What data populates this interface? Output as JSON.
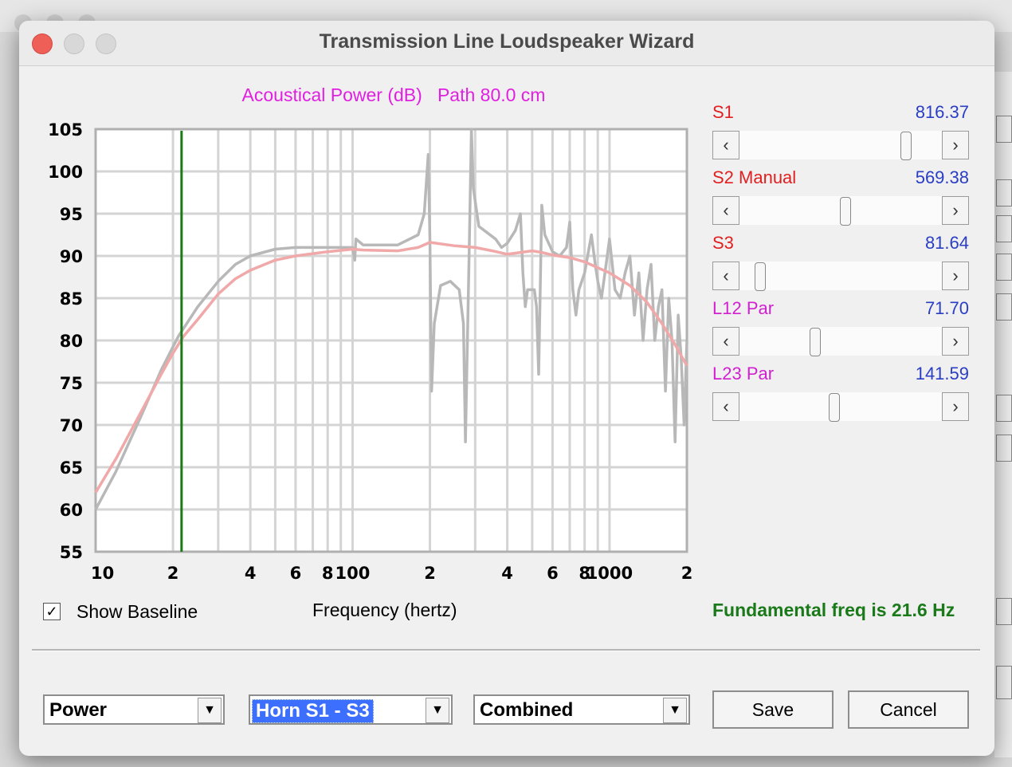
{
  "window": {
    "title": "Transmission Line Loudspeaker Wizard"
  },
  "chart_header": {
    "title": "Acoustical Power (dB)   Path 80.0 cm"
  },
  "chart_data": {
    "type": "line",
    "title": "Acoustical Power (dB)   Path 80.0 cm",
    "xlabel": "Frequency (hertz)",
    "ylabel": "",
    "x_scale": "log",
    "xlim": [
      10,
      2000
    ],
    "ylim": [
      55,
      105
    ],
    "y_ticks": [
      "105",
      "100",
      "95",
      "90",
      "85",
      "80",
      "75",
      "70",
      "65",
      "60",
      "55"
    ],
    "x_ticks": [
      {
        "value": 10,
        "label": "10"
      },
      {
        "value": 20,
        "label": "2"
      },
      {
        "value": 40,
        "label": "4"
      },
      {
        "value": 60,
        "label": "6"
      },
      {
        "value": 80,
        "label": "8"
      },
      {
        "value": 100,
        "label": "100"
      },
      {
        "value": 200,
        "label": "2"
      },
      {
        "value": 400,
        "label": "4"
      },
      {
        "value": 600,
        "label": "6"
      },
      {
        "value": 800,
        "label": "8"
      },
      {
        "value": 1000,
        "label": "1000"
      },
      {
        "value": 2000,
        "label": "2"
      }
    ],
    "marker_line": {
      "x": 21.6,
      "color": "#1a7a1a"
    },
    "series": [
      {
        "color": "#b8b8b8",
        "points": [
          [
            10,
            60
          ],
          [
            12,
            64.5
          ],
          [
            15,
            71
          ],
          [
            18,
            76.5
          ],
          [
            21,
            80.5
          ],
          [
            25,
            84
          ],
          [
            30,
            87
          ],
          [
            35,
            89
          ],
          [
            40,
            90
          ],
          [
            50,
            90.8
          ],
          [
            60,
            91
          ],
          [
            80,
            91
          ],
          [
            100,
            91
          ],
          [
            102,
            89.5
          ],
          [
            103,
            92
          ],
          [
            110,
            91.3
          ],
          [
            150,
            91.3
          ],
          [
            180,
            92.5
          ],
          [
            190,
            95
          ],
          [
            197,
            102
          ],
          [
            200,
            92
          ],
          [
            203,
            74
          ],
          [
            208,
            82
          ],
          [
            220,
            86.5
          ],
          [
            240,
            87
          ],
          [
            260,
            86
          ],
          [
            270,
            82
          ],
          [
            275,
            68
          ],
          [
            285,
            92
          ],
          [
            290,
            105
          ],
          [
            295,
            98
          ],
          [
            310,
            93.5
          ],
          [
            360,
            92
          ],
          [
            380,
            91
          ],
          [
            400,
            91.5
          ],
          [
            430,
            93
          ],
          [
            450,
            95
          ],
          [
            460,
            88
          ],
          [
            470,
            84
          ],
          [
            480,
            86
          ],
          [
            510,
            86
          ],
          [
            520,
            84
          ],
          [
            530,
            76
          ],
          [
            545,
            96
          ],
          [
            560,
            92.5
          ],
          [
            600,
            90.5
          ],
          [
            640,
            90
          ],
          [
            680,
            91
          ],
          [
            700,
            94
          ],
          [
            720,
            86
          ],
          [
            740,
            83
          ],
          [
            760,
            86
          ],
          [
            800,
            88
          ],
          [
            850,
            92.5
          ],
          [
            880,
            89
          ],
          [
            900,
            87
          ],
          [
            930,
            85
          ],
          [
            960,
            88
          ],
          [
            1000,
            92
          ],
          [
            1050,
            86
          ],
          [
            1100,
            85
          ],
          [
            1150,
            88
          ],
          [
            1200,
            90
          ],
          [
            1250,
            83
          ],
          [
            1300,
            88
          ],
          [
            1350,
            80
          ],
          [
            1400,
            86
          ],
          [
            1450,
            89
          ],
          [
            1500,
            80
          ],
          [
            1550,
            84
          ],
          [
            1600,
            86
          ],
          [
            1650,
            74
          ],
          [
            1700,
            85
          ],
          [
            1750,
            80
          ],
          [
            1800,
            68
          ],
          [
            1850,
            83
          ],
          [
            1900,
            78
          ],
          [
            1950,
            70
          ],
          [
            2000,
            80
          ]
        ]
      },
      {
        "color": "#f0a8a8",
        "points": [
          [
            10,
            62
          ],
          [
            12,
            66
          ],
          [
            15,
            71.5
          ],
          [
            18,
            76
          ],
          [
            20,
            78.5
          ],
          [
            22,
            80.5
          ],
          [
            25,
            82.5
          ],
          [
            30,
            85.5
          ],
          [
            35,
            87.3
          ],
          [
            40,
            88.3
          ],
          [
            50,
            89.5
          ],
          [
            60,
            90
          ],
          [
            80,
            90.5
          ],
          [
            100,
            90.8
          ],
          [
            110,
            90.7
          ],
          [
            150,
            90.6
          ],
          [
            180,
            91
          ],
          [
            200,
            91.6
          ],
          [
            250,
            91.2
          ],
          [
            300,
            91
          ],
          [
            350,
            90.6
          ],
          [
            400,
            90.2
          ],
          [
            500,
            90.6
          ],
          [
            550,
            90.4
          ],
          [
            600,
            90.1
          ],
          [
            700,
            89.8
          ],
          [
            800,
            89.3
          ],
          [
            900,
            88.6
          ],
          [
            1000,
            88
          ],
          [
            1200,
            86.5
          ],
          [
            1400,
            84.5
          ],
          [
            1600,
            82
          ],
          [
            1800,
            79.5
          ],
          [
            2000,
            77
          ]
        ]
      }
    ]
  },
  "controls": {
    "show_baseline_label": "Show Baseline",
    "show_baseline_checked": "✓",
    "xlabel": "Frequency (hertz)",
    "fundamental_text": "Fundamental freq is 21.6 Hz"
  },
  "sliders": [
    {
      "label": "S1",
      "label_color": "#e02020",
      "value": "816.37",
      "position": 0.85
    },
    {
      "label": "S2  Manual",
      "label_color": "#e02020",
      "value": "569.38",
      "position": 0.53
    },
    {
      "label": "S3",
      "label_color": "#e02020",
      "value": "81.64",
      "position": 0.08
    },
    {
      "label": "L12  Par",
      "label_color": "#d020d0",
      "value": "71.70",
      "position": 0.37
    },
    {
      "label": "L23  Par",
      "label_color": "#d020d0",
      "value": "141.59",
      "position": 0.47
    }
  ],
  "slider_buttons": {
    "left": "‹",
    "right": "›"
  },
  "bottom": {
    "combo_mode": "Power",
    "combo_section": "Horn S1 - S3",
    "combo_view": "Combined",
    "combo_arrow": "▼",
    "save_label": "Save",
    "cancel_label": "Cancel"
  }
}
